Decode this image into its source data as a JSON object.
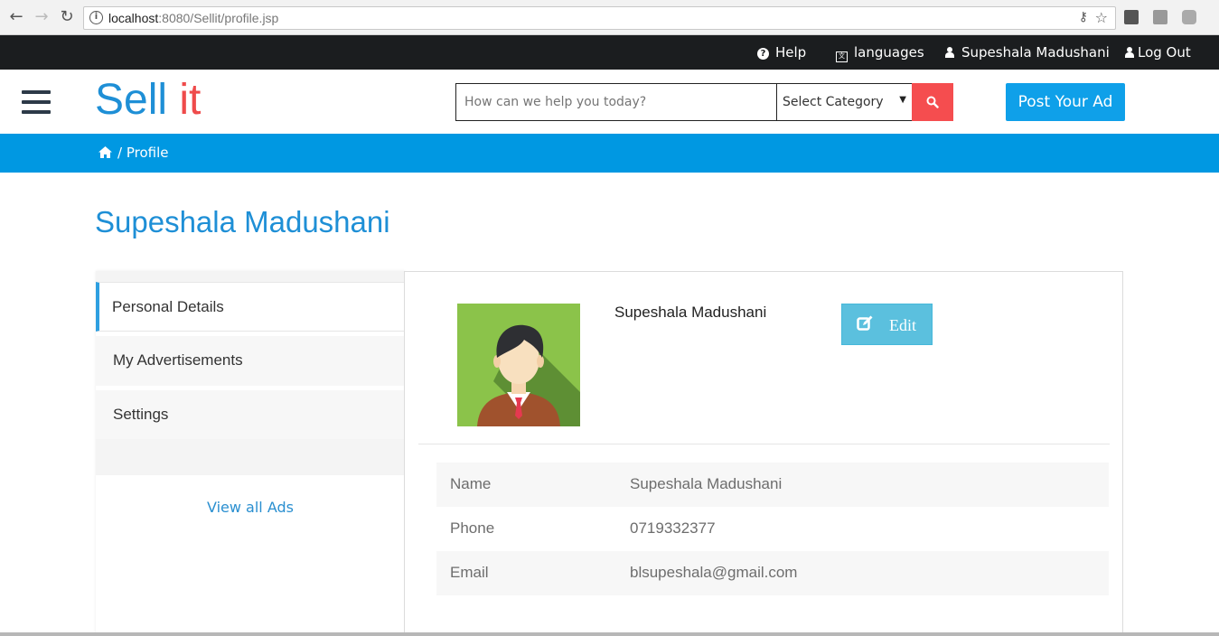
{
  "browser": {
    "url_host": "localhost",
    "url_rest": ":8080/Sellit/profile.jsp"
  },
  "topbar": {
    "help": "Help",
    "languages": "languages",
    "user": "Supeshala Madushani",
    "logout": "Log Out"
  },
  "header": {
    "logo_sell": "Sell",
    "logo_it": "it",
    "search_placeholder": "How can we help you today?",
    "category_selected": "Select Category",
    "post_ad": "Post Your Ad"
  },
  "breadcrumb": {
    "current": "/ Profile"
  },
  "page_title": "Supeshala Madushani",
  "sidebar": {
    "items": [
      {
        "label": "Personal Details"
      },
      {
        "label": "My Advertisements"
      },
      {
        "label": "Settings"
      }
    ],
    "view_all": "View all Ads"
  },
  "profile": {
    "name": "Supeshala Madushani",
    "edit_label": "Edit",
    "details": [
      {
        "label": "Name",
        "value": "Supeshala Madushani"
      },
      {
        "label": "Phone",
        "value": "0719332377"
      },
      {
        "label": "Email",
        "value": "blsupeshala@gmail.com"
      }
    ]
  },
  "colors": {
    "brand_blue": "#1e8fd6",
    "brand_red": "#ef4b4b",
    "breadcrumb_bg": "#0098e2",
    "search_button": "#f54d4f",
    "edit_button": "#5bc0de"
  }
}
